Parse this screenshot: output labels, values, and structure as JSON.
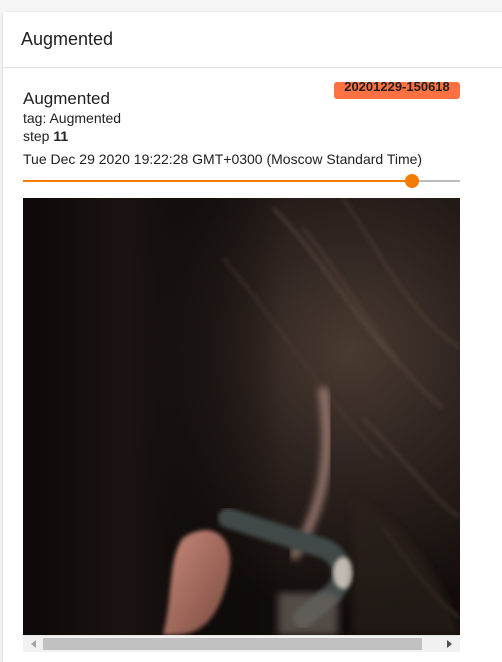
{
  "panel": {
    "title": "Augmented"
  },
  "card": {
    "run_name": "20201229-150618",
    "title": "Augmented",
    "tag_label": "tag: Augmented",
    "step_label": "step",
    "step_value": "11",
    "timestamp": "Tue Dec 29 2020 19:22:28 GMT+0300 (Moscow Standard Time)"
  },
  "slider": {
    "value_fraction": 0.89
  },
  "image": {
    "alt": "augmented training image"
  },
  "colors": {
    "accent": "#f57c00",
    "badge": "#ff7043"
  }
}
